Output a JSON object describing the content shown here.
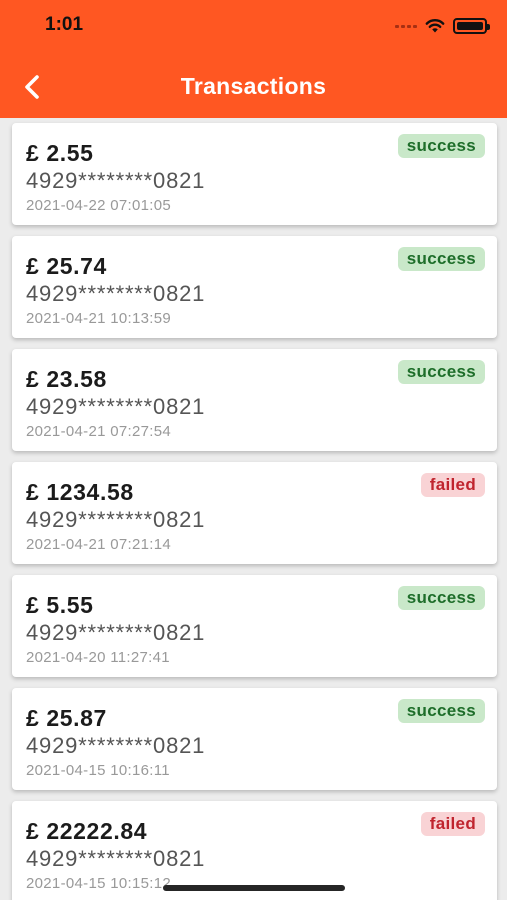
{
  "status_bar": {
    "time": "1:01",
    "icons": [
      "signal-icon",
      "wifi-icon",
      "battery-icon"
    ]
  },
  "header": {
    "title": "Transactions",
    "back_icon": "chevron-left-icon",
    "background_color": "#ff5722"
  },
  "transactions": [
    {
      "amount": "£ 2.55",
      "card": "4929********0821",
      "datetime": "2021-04-22 07:01:05",
      "status": "success"
    },
    {
      "amount": "£ 25.74",
      "card": "4929********0821",
      "datetime": "2021-04-21 10:13:59",
      "status": "success"
    },
    {
      "amount": "£ 23.58",
      "card": "4929********0821",
      "datetime": "2021-04-21 07:27:54",
      "status": "success"
    },
    {
      "amount": "£ 1234.58",
      "card": "4929********0821",
      "datetime": "2021-04-21 07:21:14",
      "status": "failed"
    },
    {
      "amount": "£ 5.55",
      "card": "4929********0821",
      "datetime": "2021-04-20 11:27:41",
      "status": "success"
    },
    {
      "amount": "£ 25.87",
      "card": "4929********0821",
      "datetime": "2021-04-15 10:16:11",
      "status": "success"
    },
    {
      "amount": "£ 22222.84",
      "card": "4929********0821",
      "datetime": "2021-04-15 10:15:12",
      "status": "failed"
    }
  ],
  "status_colors": {
    "success_bg": "#c9e8c9",
    "success_text": "#1e6e2a",
    "failed_bg": "#f9d3d5",
    "failed_text": "#c0242e"
  }
}
